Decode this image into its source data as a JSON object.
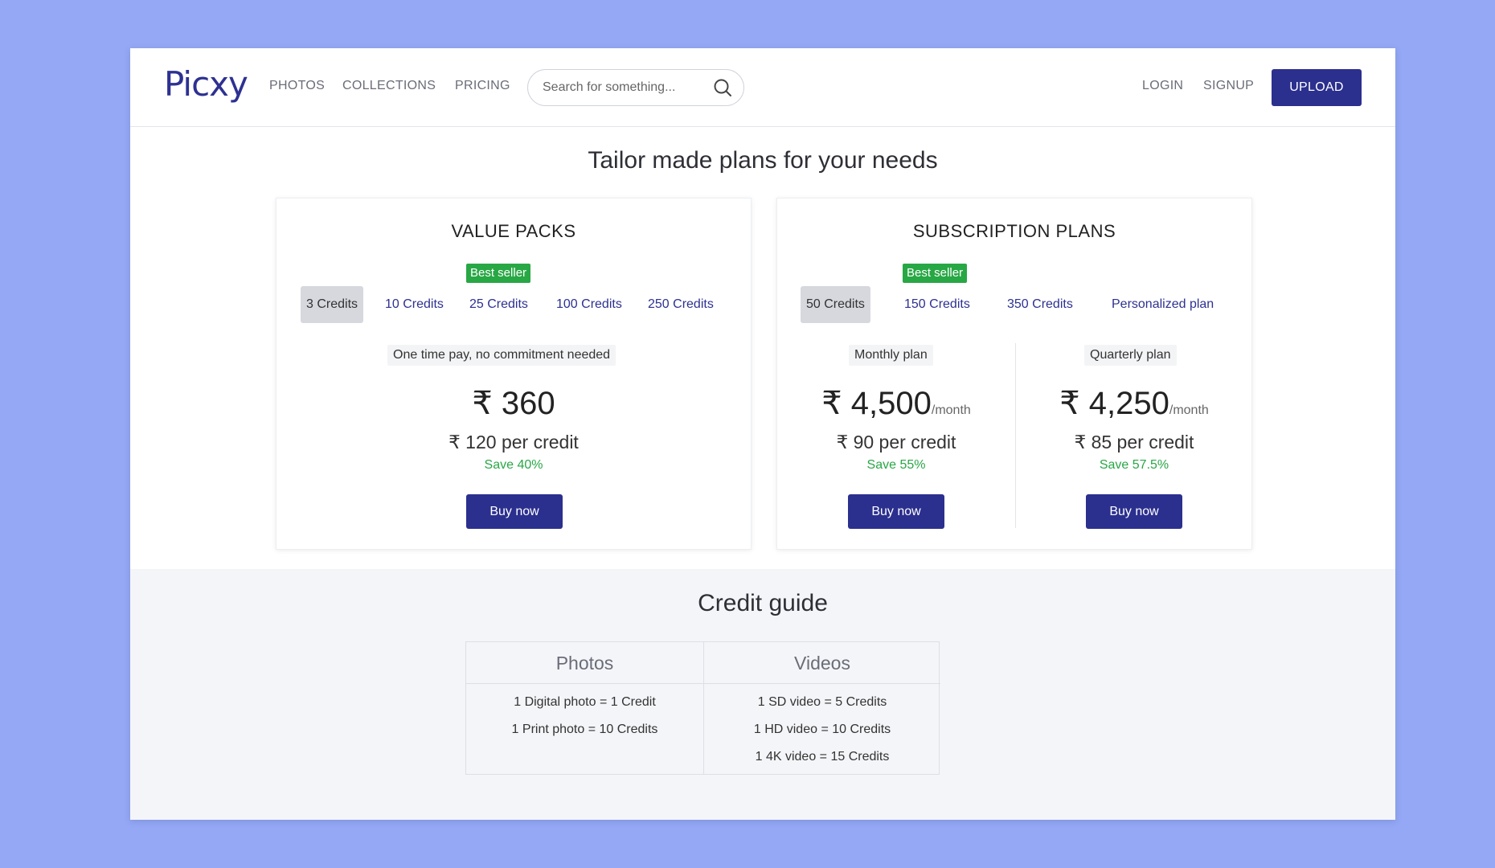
{
  "header": {
    "logo": "Picxy",
    "nav": [
      "PHOTOS",
      "COLLECTIONS",
      "PRICING"
    ],
    "search_placeholder": "Search for something...",
    "login": "LOGIN",
    "signup": "SIGNUP",
    "upload": "UPLOAD"
  },
  "page_title": "Tailor made plans for your needs",
  "value_packs": {
    "title": "VALUE PACKS",
    "badge": "Best seller",
    "tabs": [
      "3 Credits",
      "10 Credits",
      "25 Credits",
      "100 Credits",
      "250 Credits"
    ],
    "active_tab": "3 Credits",
    "note": "One time pay, no commitment needed",
    "price": "₹ 360",
    "per_credit": "₹ 120 per credit",
    "save": "Save 40%",
    "buy": "Buy now"
  },
  "subscription_plans": {
    "title": "SUBSCRIPTION PLANS",
    "badge": "Best seller",
    "tabs": [
      "50 Credits",
      "150 Credits",
      "350 Credits",
      "Personalized plan"
    ],
    "active_tab": "50 Credits",
    "plans": [
      {
        "label": "Monthly plan",
        "price": "₹ 4,500",
        "unit": "/month",
        "per_credit": "₹ 90 per credit",
        "save": "Save 55%",
        "buy": "Buy now"
      },
      {
        "label": "Quarterly plan",
        "price": "₹ 4,250",
        "unit": "/month",
        "per_credit": "₹ 85 per credit",
        "save": "Save 57.5%",
        "buy": "Buy now"
      }
    ]
  },
  "credit_guide": {
    "title": "Credit guide",
    "columns": [
      {
        "header": "Photos",
        "rows": [
          "1 Digital photo = 1 Credit",
          "1 Print photo = 10 Credits"
        ]
      },
      {
        "header": "Videos",
        "rows": [
          "1 SD video = 5 Credits",
          "1 HD video = 10 Credits",
          "1 4K video = 15 Credits"
        ]
      }
    ]
  },
  "colors": {
    "background": "#94a8f5",
    "brand": "#2b2f8e",
    "success": "#28a745"
  }
}
